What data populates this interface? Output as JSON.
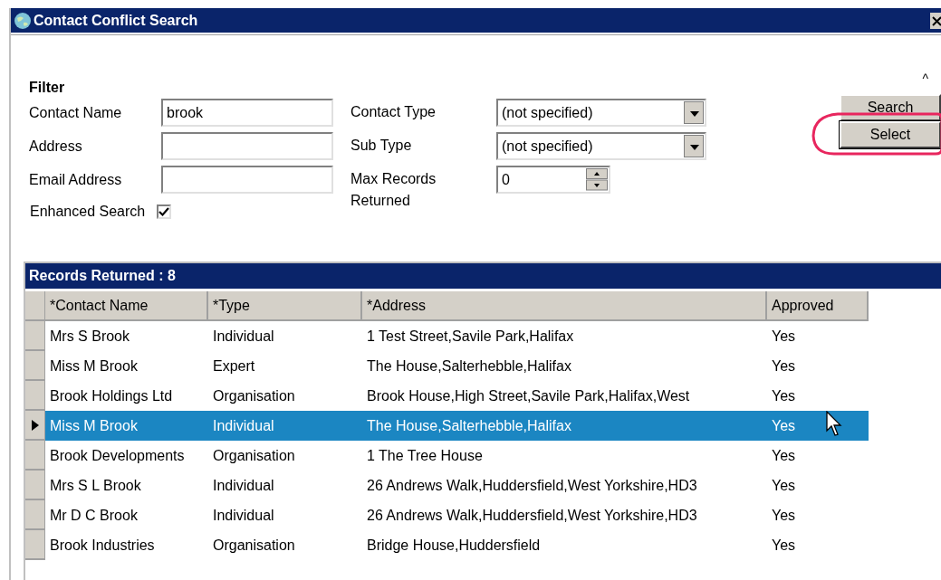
{
  "window": {
    "title": "Contact Conflict Search"
  },
  "filter": {
    "title": "Filter",
    "collapse_glyph": "^",
    "fields": [
      {
        "kind": "text",
        "label": "Contact Name",
        "value": "brook"
      },
      {
        "kind": "text",
        "label": "Address"
      },
      {
        "kind": "text",
        "label": "Email Address"
      }
    ],
    "enhanced_search": {
      "label": "Enhanced Search",
      "checked": true
    },
    "right_fields": [
      {
        "kind": "dropdown",
        "label": "Contact Type",
        "value": "(not specified)"
      },
      {
        "kind": "dropdown",
        "label": "Sub Type",
        "value": "(not specified)"
      },
      {
        "kind": "spin",
        "label": "Max Records Returned",
        "value": "0"
      }
    ]
  },
  "buttons": [
    {
      "label": "Search",
      "highlighted": false
    },
    {
      "label": "Select",
      "highlighted": true
    }
  ],
  "table": {
    "title": "Records Returned : 8",
    "columns": [
      "*Contact Name",
      "*Type",
      "*Address",
      "Approved"
    ],
    "rows": [
      {
        "cells": [
          "Mrs S Brook",
          "Individual",
          "1 Test Street,Savile Park,Halifax",
          "Yes"
        ],
        "selected": false
      },
      {
        "cells": [
          "Miss M Brook",
          "Expert",
          "The House,Salterhebble,Halifax",
          "Yes"
        ],
        "selected": false
      },
      {
        "cells": [
          "Brook Holdings Ltd",
          "Organisation",
          "Brook House,High Street,Savile Park,Halifax,West",
          "Yes"
        ],
        "selected": false
      },
      {
        "cells": [
          "Miss M Brook",
          "Individual",
          "The House,Salterhebble,Halifax",
          "Yes"
        ],
        "selected": true
      },
      {
        "cells": [
          "Brook Developments",
          "Organisation",
          "1 The Tree House",
          "Yes"
        ],
        "selected": false
      },
      {
        "cells": [
          "Mrs S L Brook",
          "Individual",
          "26 Andrews Walk,Huddersfield,West Yorkshire,HD3",
          "Yes"
        ],
        "selected": false
      },
      {
        "cells": [
          "Mr D C Brook",
          "Individual",
          "26 Andrews Walk,Huddersfield,West Yorkshire,HD3",
          "Yes"
        ],
        "selected": false
      },
      {
        "cells": [
          "Brook Industries",
          "Organisation",
          "Bridge House,Huddersfield",
          "Yes"
        ],
        "selected": false
      }
    ]
  }
}
